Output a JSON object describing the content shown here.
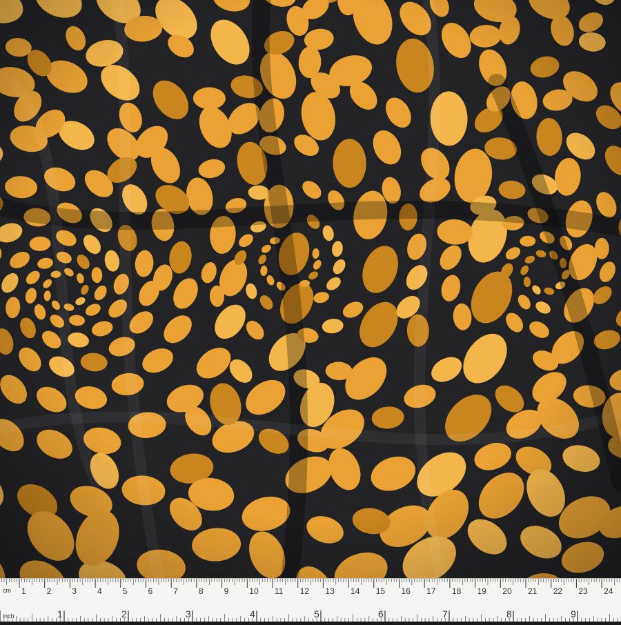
{
  "photo": {
    "subject": "fabric-swatch",
    "colors": {
      "background": "#232326",
      "background_shadow": "#151517",
      "dot": "#e9a233",
      "dot_highlight": "#f3b64b",
      "dot_shadow": "#c9861f",
      "ruler": "#f4f4f2",
      "ruler_ink": "#333333"
    }
  },
  "ruler": {
    "cm_unit": "cm",
    "inch_unit": "inch",
    "cm_labels": [
      "1",
      "2",
      "3",
      "4",
      "5",
      "6",
      "7",
      "8",
      "9",
      "10",
      "11",
      "12",
      "13",
      "14",
      "15",
      "16",
      "17",
      "18",
      "19",
      "20",
      "21",
      "22",
      "23",
      "24"
    ],
    "inch_labels": [
      "1",
      "2",
      "3",
      "4",
      "5",
      "6",
      "7",
      "8",
      "9"
    ]
  }
}
